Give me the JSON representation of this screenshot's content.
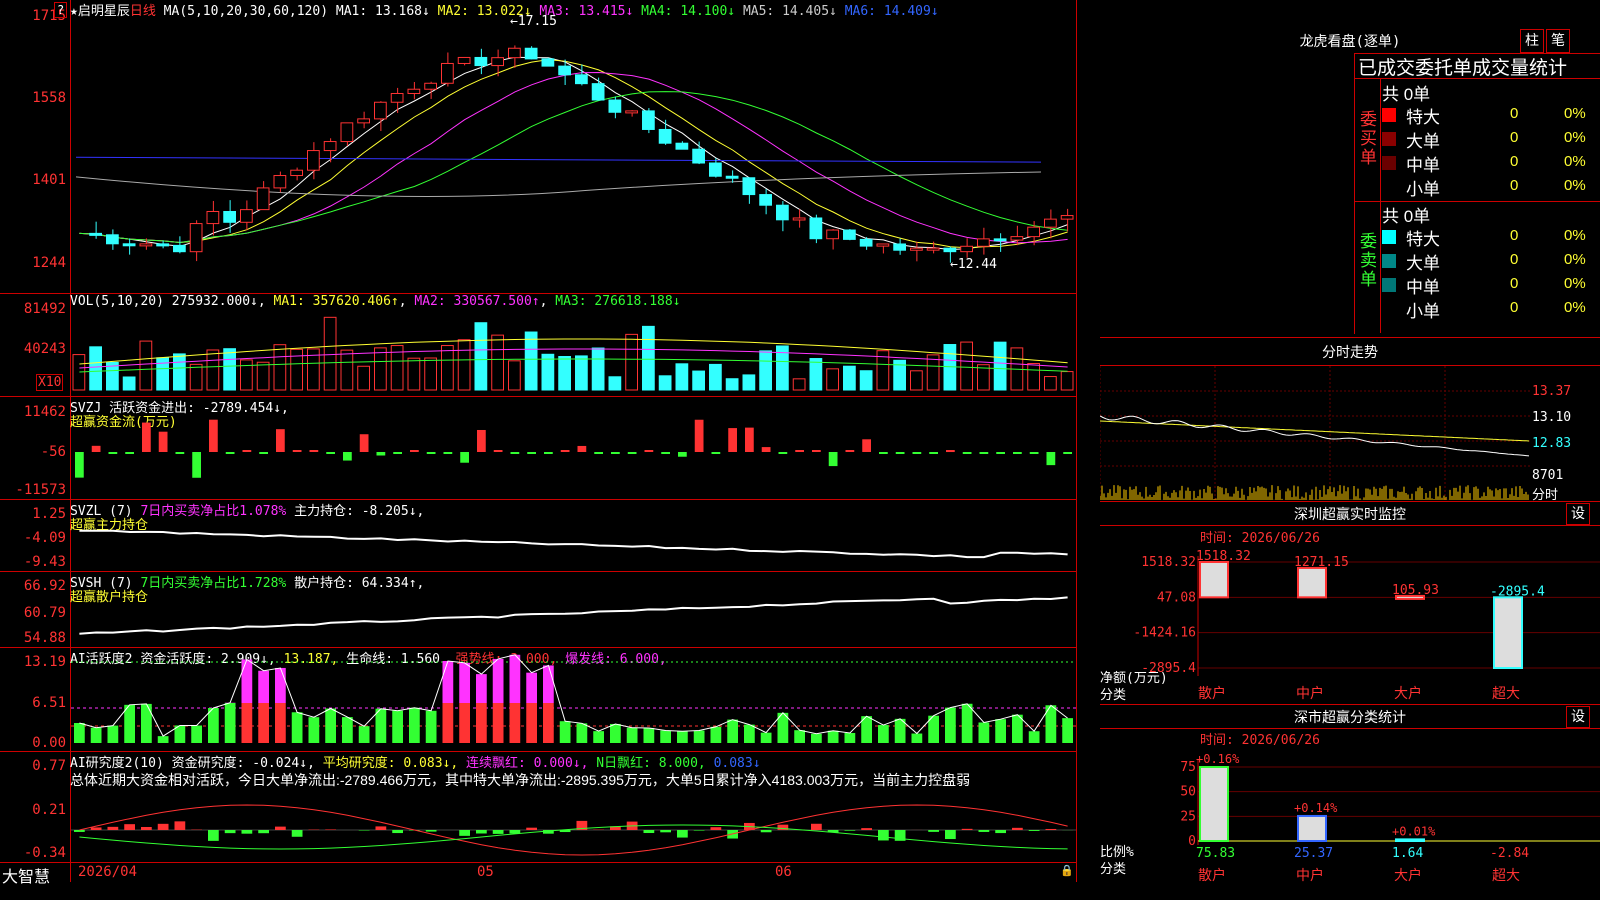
{
  "stock": {
    "name": "★启明星辰",
    "period": "日线"
  },
  "pane_price": {
    "ma_label": "MA(5,10,20,30,60,120)",
    "ma": [
      {
        "name": "MA1",
        "value": "13.168↓",
        "color": "#ffffff"
      },
      {
        "name": "MA2",
        "value": "13.022↓",
        "color": "#ffff33"
      },
      {
        "name": "MA3",
        "value": "13.415↓",
        "color": "#ff33ff"
      },
      {
        "name": "MA4",
        "value": "14.100↓",
        "color": "#33ff33"
      },
      {
        "name": "MA5",
        "value": "14.405↓",
        "color": "#cccccc"
      },
      {
        "name": "MA6",
        "value": "14.409↓",
        "color": "#3366ff"
      }
    ],
    "ticks": [
      "1715",
      "1558",
      "1401",
      "1244"
    ],
    "high_label": "←17.15",
    "low_label": "←12.44",
    "corner": "?"
  },
  "pane_vol": {
    "label": "VOL(5,10,20)",
    "value": "275932.000↓",
    "ma1": "MA1: 357620.406↑",
    "ma2": "MA2: 330567.500↑",
    "ma3": "MA3: 276618.188↓",
    "ticks": [
      "81492",
      "40243"
    ],
    "unit": "X10"
  },
  "pane_svzj": {
    "label": "SVZJ  活跃资金进出: -2789.454↓,",
    "sub": "超赢资金流(万元)",
    "ticks": [
      "11462",
      "-56",
      "-11573"
    ]
  },
  "pane_svzl": {
    "label1": "SVZL (7)",
    "label2": "7日内买卖净占比1.078%",
    "label3": "主力持仓: -8.205↓,",
    "sub": "超赢主力持仓",
    "ticks": [
      "1.25",
      "-4.09",
      "-9.43"
    ]
  },
  "pane_svsh": {
    "label1": "SVSH (7)",
    "label2": "7日内买卖净占比1.728%",
    "label3": "散户持仓: 64.334↑,",
    "sub": "超赢散户持仓",
    "ticks": [
      "66.92",
      "60.79",
      "54.88"
    ]
  },
  "pane_ai": {
    "label1": "AI活跃度2",
    "label2": "资金活跃度: 2.909↓,",
    "label3": "13.187,",
    "label4": "生命线: 1.560,",
    "label5": "强势线: 3.000,",
    "label6": "爆发线: 6.000,",
    "ticks": [
      "13.19",
      "6.51",
      "0.00"
    ]
  },
  "pane_research": {
    "label1": "AI研究度2(10)",
    "label2": "资金研究度: -0.024↓,",
    "label3": "平均研究度: 0.083↓,",
    "label4": "连续飘红: 0.000↓,",
    "label5": "N日飘红: 8.000,",
    "label6": "0.083↓",
    "summary": "总体近期大资金相对活跃，今日大单净流出:-2789.466万元，其中特大单净流出:-2895.395万元，大单5日累计净入4183.003万元，当前主力控盘弱",
    "ticks": [
      "0.77",
      "0.21",
      "-0.34"
    ]
  },
  "bottom": {
    "brand": "大智慧",
    "date": "2026/04",
    "month1": "05",
    "month2": "06"
  },
  "dragon_tiger": {
    "title": "龙虎看盘(逐单)",
    "tab1": "柱",
    "tab2": "笔",
    "header": "已成交委托单成交量统计",
    "buy": {
      "side_label": "委买单",
      "total": "共 0单",
      "rows": [
        {
          "label": "特大",
          "count": "0",
          "pct": "0%",
          "color": "#ff0000"
        },
        {
          "label": "大单",
          "count": "0",
          "pct": "0%",
          "color": "#8b0000"
        },
        {
          "label": "中单",
          "count": "0",
          "pct": "0%",
          "color": "#6a0000"
        },
        {
          "label": "小单",
          "count": "0",
          "pct": "0%",
          "color": ""
        }
      ]
    },
    "sell": {
      "side_label": "委卖单",
      "total": "共 0单",
      "rows": [
        {
          "label": "特大",
          "count": "0",
          "pct": "0%",
          "color": "#00ffff"
        },
        {
          "label": "大单",
          "count": "0",
          "pct": "0%",
          "color": "#008888"
        },
        {
          "label": "中单",
          "count": "0",
          "pct": "0%",
          "color": "#007777"
        },
        {
          "label": "小单",
          "count": "0",
          "pct": "0%",
          "color": ""
        }
      ]
    }
  },
  "intraday": {
    "title": "分时走势",
    "ticks": [
      "13.37",
      "13.10",
      "12.83"
    ],
    "vol_tick": "8701",
    "label": "分时"
  },
  "monitor": {
    "title": "深圳超赢实时监控",
    "set": "设",
    "time": "时间: 2026/06/26",
    "ylabels": [
      "1518.32",
      "47.08",
      "-1424.16",
      "-2895.4"
    ],
    "yname": "净额(万元)",
    "xname": "分类",
    "bars": [
      {
        "cat": "散户",
        "value": "1518.32",
        "color": "#ff3333"
      },
      {
        "cat": "中户",
        "value": "1271.15",
        "color": "#ff3333"
      },
      {
        "cat": "大户",
        "value": "105.93",
        "color": "#ff3333"
      },
      {
        "cat": "超大",
        "value": "-2895.4",
        "color": "#33ffff"
      }
    ]
  },
  "classify": {
    "title": "深市超赢分类统计",
    "set": "设",
    "time": "时间: 2026/06/26",
    "yticks": [
      "75",
      "50",
      "25",
      "0"
    ],
    "yname": "比例%",
    "xname": "分类",
    "bars": [
      {
        "cat": "散户",
        "value": "75.83",
        "delta": "+0.16%",
        "color": "#33ff33"
      },
      {
        "cat": "中户",
        "value": "25.37",
        "delta": "+0.14%",
        "color": "#3366ff"
      },
      {
        "cat": "大户",
        "value": "1.64",
        "delta": "+0.01%",
        "color": "#33ffff"
      },
      {
        "cat": "超大",
        "value": "-2.84",
        "delta": "",
        "color": "#ff3333"
      }
    ]
  }
}
